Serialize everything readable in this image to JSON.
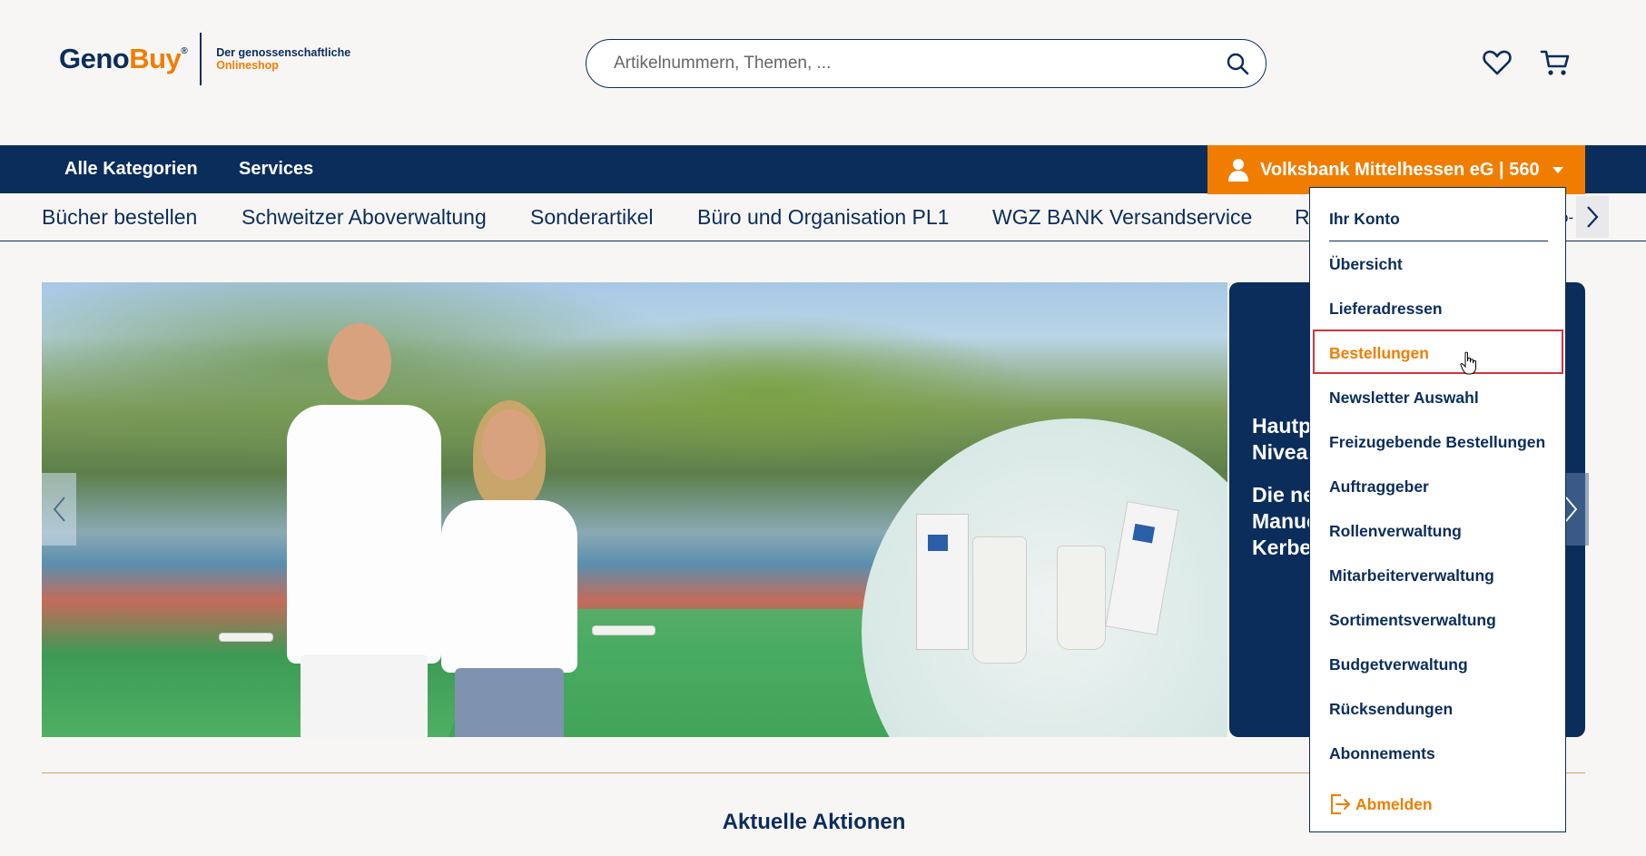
{
  "header": {
    "logo_geno": "Geno",
    "logo_buy": "Buy",
    "logo_reg": "®",
    "tagline_1": "Der genossenschaftliche",
    "tagline_2": "Onlineshop",
    "search_placeholder": "Artikelnummern, Themen, ..."
  },
  "mainnav": {
    "items": [
      "Alle Kategorien",
      "Services"
    ],
    "account_label": "Volksbank Mittelhessen eG  | 560"
  },
  "subnav": {
    "items": [
      "Bücher bestellen",
      "Schweitzer Aboverwaltung",
      "Sonderartikel",
      "Büro und Organisation PL1",
      "WGZ BANK Versandservice",
      "R",
      "o-"
    ]
  },
  "hero": {
    "side_text_1": "Hautp\nNivea",
    "side_text_2": "Die ne\nManue\nKerbe"
  },
  "section": {
    "title": "Aktuelle Aktionen"
  },
  "dropdown": {
    "items": [
      "Ihr Konto",
      "Übersicht",
      "Lieferadressen",
      "Bestellungen",
      "Newsletter Auswahl",
      "Freizugebende Bestellungen",
      "Auftraggeber",
      "Rollenverwaltung",
      "Mitarbeiterverwaltung",
      "Sortimentsverwaltung",
      "Budgetverwaltung",
      "Rücksendungen",
      "Abonnements"
    ],
    "logout": "Abmelden",
    "active": "Bestellungen"
  },
  "colors": {
    "navy": "#0a2d5c",
    "orange": "#f07d00",
    "highlight_border": "#d2343b"
  }
}
